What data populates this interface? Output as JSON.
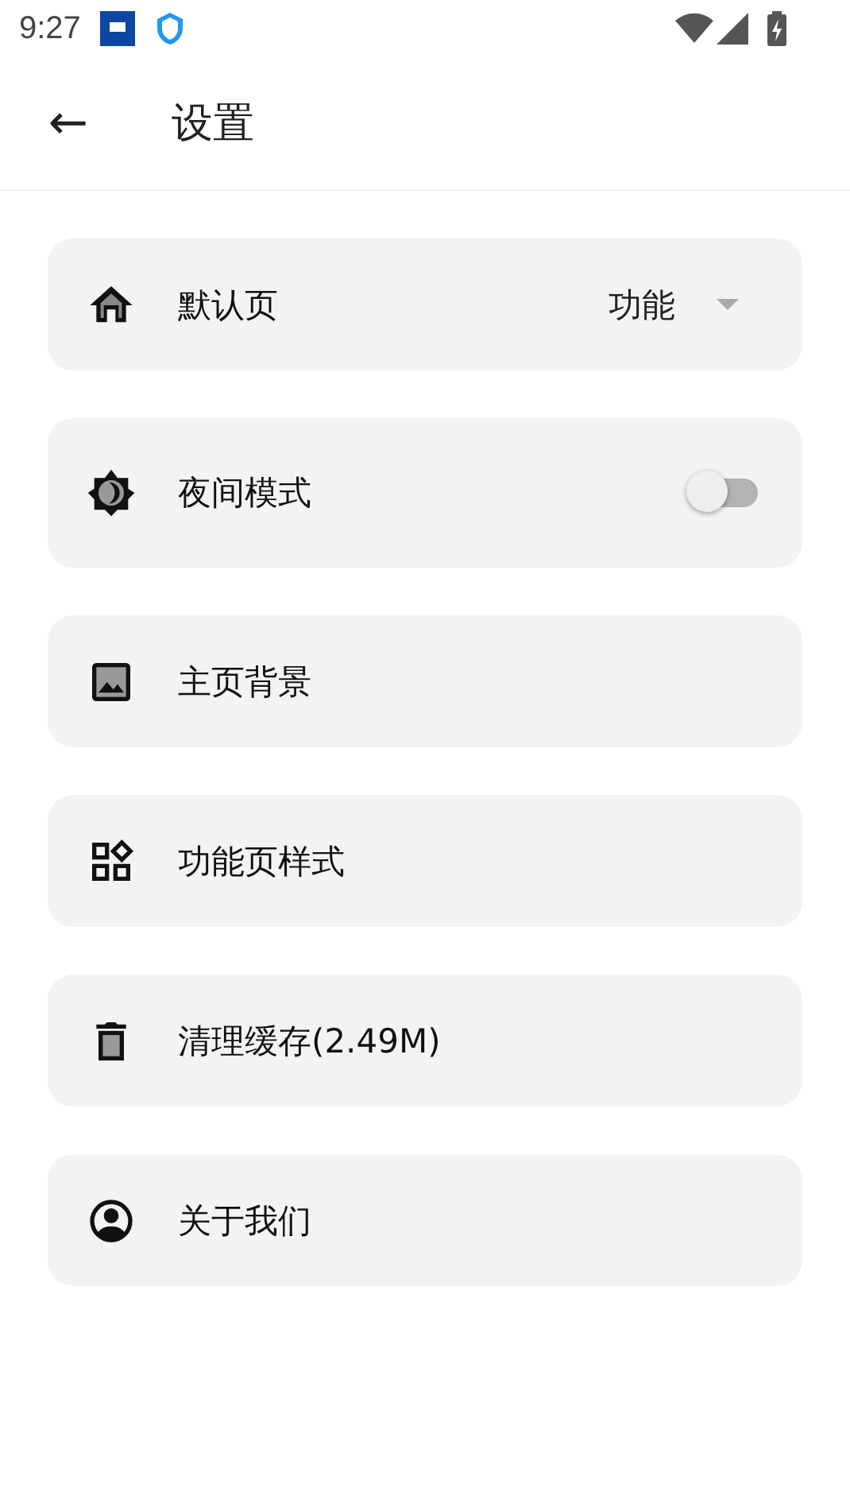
{
  "status_bar": {
    "time": "9:27"
  },
  "header": {
    "back": "←",
    "title": "设置"
  },
  "items": [
    {
      "kind": "select",
      "label": "默认页",
      "value": "功能"
    },
    {
      "kind": "switch",
      "label": "夜间模式",
      "on": false
    },
    {
      "kind": "link",
      "label": "主页背景"
    },
    {
      "kind": "link",
      "label": "功能页样式"
    },
    {
      "kind": "link",
      "label": "清理缓存(2.49M)"
    },
    {
      "kind": "link",
      "label": "关于我们"
    }
  ]
}
